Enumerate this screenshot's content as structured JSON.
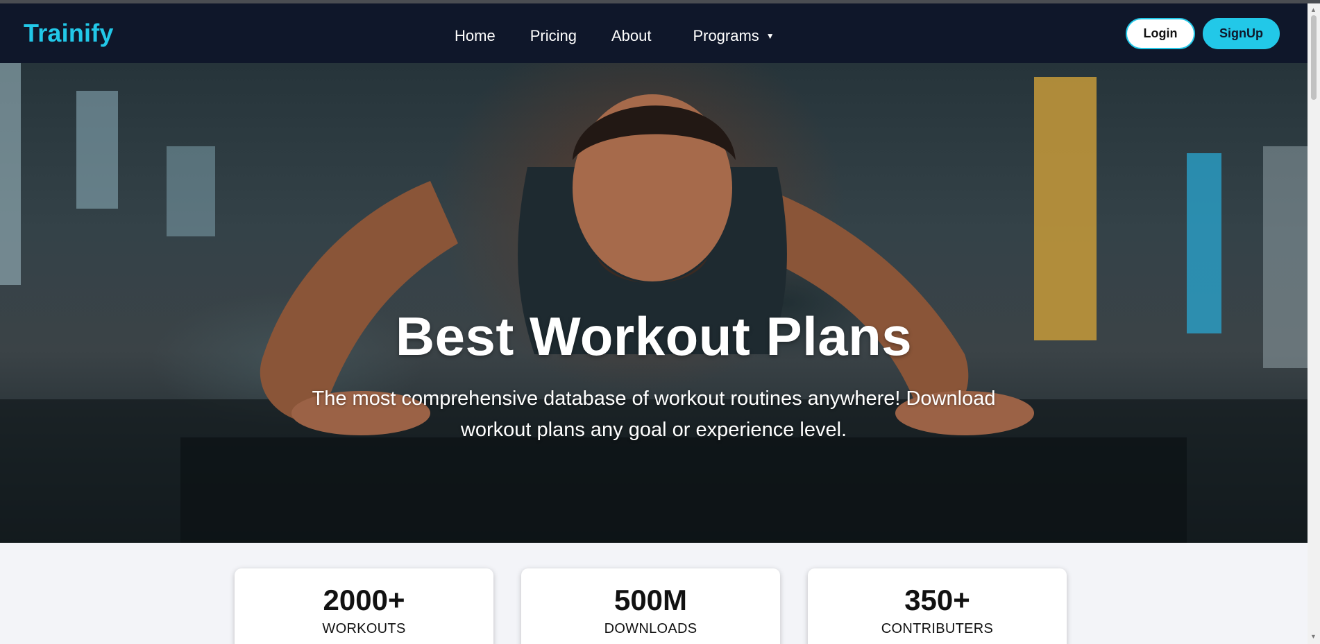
{
  "navbar": {
    "brand": "Trainify",
    "links": [
      {
        "label": "Home"
      },
      {
        "label": "Pricing"
      },
      {
        "label": "About"
      },
      {
        "label": "Programs",
        "icon": "caret-down-icon"
      }
    ],
    "login_label": "Login",
    "signup_label": "SignUp"
  },
  "hero": {
    "title": "Best Workout Plans",
    "subtitle_line1": "The most comprehensive database of workout routines anywhere! Download",
    "subtitle_line2": "workout plans any goal or experience level.",
    "background_image": "man doing push-ups in a gym"
  },
  "stats": [
    {
      "value": "2000+",
      "label": "WORKOUTS"
    },
    {
      "value": "500M",
      "label": "DOWNLOADS"
    },
    {
      "value": "350+",
      "label": "CONTRIBUTERS"
    }
  ],
  "colors": {
    "navbar_bg": "#0f172a",
    "accent": "#22c8e8",
    "page_bg": "#f3f4f8"
  }
}
